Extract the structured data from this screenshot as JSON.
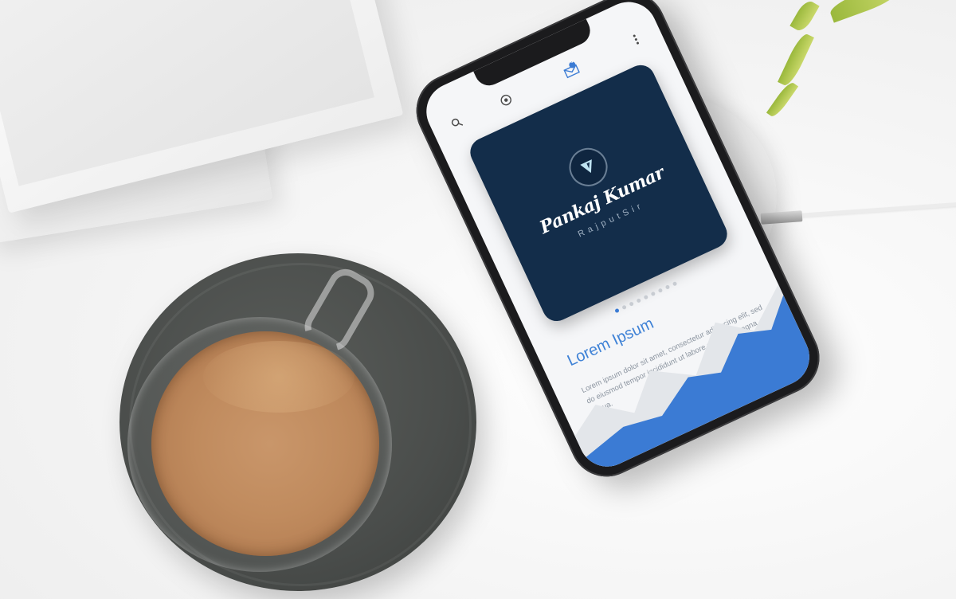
{
  "scene": {
    "description_items": [
      "books",
      "plant",
      "wireless-charger",
      "coffee-cup",
      "smartphone"
    ]
  },
  "phone": {
    "top_icons": [
      "search-icon",
      "target-icon",
      "mail-icon",
      "more-icon"
    ],
    "mail_badge": "4",
    "card": {
      "name": "Pankaj Kumar",
      "subtitle": "RajputSir"
    },
    "carousel": {
      "total": 9,
      "active_index": 0
    },
    "heading": "Lorem Ipsum",
    "body": "Lorem ipsum dolor sit amet, consectetur adipiscing elit, sed do eiusmod tempor incididunt ut labore et dolore magna aliqua.",
    "colors": {
      "card_bg": "#132d4a",
      "accent": "#3f82d6",
      "wave": "#3b7bd4"
    }
  }
}
